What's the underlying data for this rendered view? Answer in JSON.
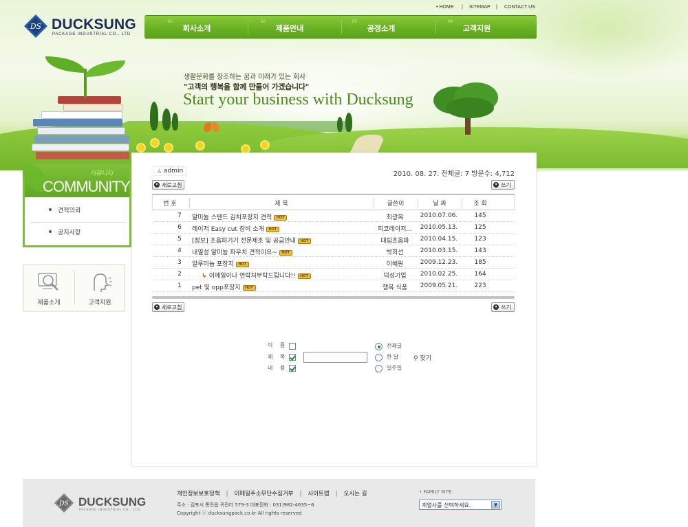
{
  "brand": {
    "name": "DUCKSUNG",
    "tagline": "PACKAGE INDUSTRIAL CO., LTD"
  },
  "util_links": [
    "• HOME",
    "|",
    "SITEMAP",
    "|",
    "CONTACT US"
  ],
  "gnb": [
    {
      "num": "01",
      "label": "회사소개"
    },
    {
      "num": "02",
      "label": "제품안내"
    },
    {
      "num": "03",
      "label": "공정소개"
    },
    {
      "num": "04",
      "label": "고객지원"
    }
  ],
  "hero": {
    "line1": "생활문화를 창조하는 꿈과 미래가 있는 회사",
    "line2": "\"고객의 행복을 함께 만들어 가겠습니다\"",
    "line3": "Start your business with Ducksung"
  },
  "sidebar": {
    "head_kr": "커뮤니티",
    "head_en": "COMMUNITY",
    "items": [
      {
        "label": "견적의뢰"
      },
      {
        "label": "공지사항"
      }
    ],
    "quick": [
      {
        "label": "제품소개",
        "icon": "magnifier-monitor-icon"
      },
      {
        "label": "고객지원",
        "icon": "support-person-icon"
      }
    ]
  },
  "board": {
    "user": "admin",
    "stats": "2010. 08. 27.  전체글: 7  방문수: 4,712",
    "refresh_label": "새로고침",
    "write_label": "쓰기",
    "hot_label": "HOT",
    "columns": [
      "번 호",
      "제   목",
      "글쓴이",
      "날 짜",
      "조 회"
    ],
    "rows": [
      {
        "no": "7",
        "title": "알미늄 스탠드 김치포장지 견적",
        "author": "최광복",
        "date": "2010.07.06.",
        "views": "145",
        "reply": false
      },
      {
        "no": "6",
        "title": "레이저 Easy cut 장비 소개",
        "author": "피코레이저...",
        "date": "2010.05.13.",
        "views": "125",
        "reply": false
      },
      {
        "no": "5",
        "title": "[정보] 초음파기기 전문제조 및 공급안내",
        "author": "대림초음파",
        "date": "2010.04.15.",
        "views": "123",
        "reply": false
      },
      {
        "no": "4",
        "title": "내열성 알미늄 파우치 견적이요~",
        "author": "박희선",
        "date": "2010.03.15.",
        "views": "143",
        "reply": false
      },
      {
        "no": "3",
        "title": "알루미늄 포장지",
        "author": "이혜원",
        "date": "2009.12.23.",
        "views": "185",
        "reply": false
      },
      {
        "no": "2",
        "title": "이메일이나 연락처부탁드립니다!!",
        "author": "덕성기업",
        "date": "2010.02.25.",
        "views": "164",
        "reply": true
      },
      {
        "no": "1",
        "title": "pet 및 opp포장지",
        "author": "행복 식품",
        "date": "2009.05.21.",
        "views": "223",
        "reply": false
      }
    ]
  },
  "search": {
    "fields": [
      {
        "label": "이 름",
        "checked": false
      },
      {
        "label": "제 목",
        "checked": true
      },
      {
        "label": "내 용",
        "checked": true
      }
    ],
    "input_value": "",
    "scopes": [
      {
        "label": "전체글",
        "selected": true
      },
      {
        "label": "한 달",
        "selected": false
      },
      {
        "label": "일주일",
        "selected": false
      }
    ],
    "find_label": "찾기"
  },
  "footer": {
    "links": [
      "개인정보보호정책",
      "이메일주소무단수집거부",
      "사이트맵",
      "오시는 길"
    ],
    "address": "주소 : 김포시 통진읍 귀전리 579-3    대표전화 : 031)982-4635~6",
    "copyright": "Copyright ⓒ ducksungpack.co.kr  All rights reserved",
    "family_label": "• FAMILY SITE",
    "family_selected": "계열사를 선택하세요."
  },
  "colors": {
    "brand_navy": "#1d2c57",
    "nav_green": "#6ab023",
    "accent_green": "#7dbd3a",
    "hot_badge": "#f2c12e"
  }
}
